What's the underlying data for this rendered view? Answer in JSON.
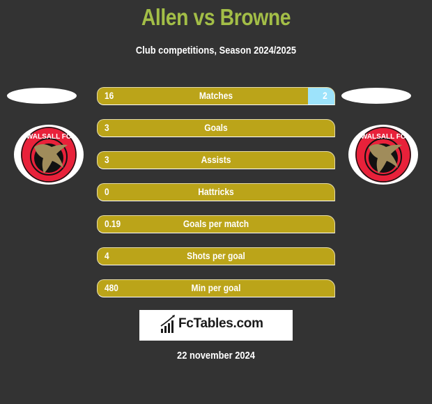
{
  "header": {
    "title": "Allen vs Browne",
    "subtitle": "Club competitions, Season 2024/2025"
  },
  "players": {
    "left": {
      "name": "Allen",
      "club": "Walsall FC",
      "badge_text": "WALSALL FC"
    },
    "right": {
      "name": "Browne",
      "club": "Walsall FC",
      "badge_text": "WALSALL FC"
    }
  },
  "colors": {
    "title": "#a3be47",
    "left_bar": "#bba419",
    "right_bar": "#9de3fb",
    "background": "#333333",
    "badge_red": "#e8213a",
    "badge_gold": "#a08c5b"
  },
  "stats": [
    {
      "label": "Matches",
      "left": "16",
      "right": "2",
      "right_share": 0.111
    },
    {
      "label": "Goals",
      "left": "3",
      "right": "",
      "right_share": 0
    },
    {
      "label": "Assists",
      "left": "3",
      "right": "",
      "right_share": 0
    },
    {
      "label": "Hattricks",
      "left": "0",
      "right": "",
      "right_share": 0
    },
    {
      "label": "Goals per match",
      "left": "0.19",
      "right": "",
      "right_share": 0
    },
    {
      "label": "Shots per goal",
      "left": "4",
      "right": "",
      "right_share": 0
    },
    {
      "label": "Min per goal",
      "left": "480",
      "right": "",
      "right_share": 0
    }
  ],
  "footer": {
    "logo_text": "FcTables.com",
    "logo_icon": "bar-chart-icon",
    "date": "22 november 2024"
  }
}
